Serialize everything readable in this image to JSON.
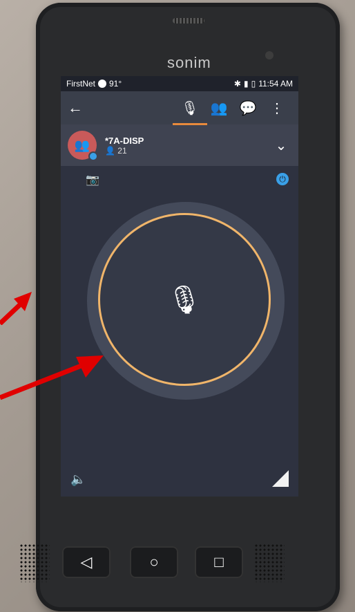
{
  "device": {
    "brand": "sonim"
  },
  "status_bar": {
    "carrier": "FirstNet",
    "extra": "91°",
    "time": "11:54 AM"
  },
  "toolbar": {
    "back_icon": "arrow-left-icon",
    "tabs": [
      {
        "icon": "microphone-icon",
        "active": true
      },
      {
        "icon": "group-icon",
        "active": false
      },
      {
        "icon": "message-icon",
        "active": false
      },
      {
        "icon": "more-vertical-icon",
        "active": false
      }
    ]
  },
  "group": {
    "name": "*7A-DISP",
    "members": "21"
  },
  "ptt": {
    "icon": "microphone-icon",
    "ring_color": "#f0b56a"
  },
  "colors": {
    "accent": "#e88a3c",
    "blue": "#3aa0e8",
    "arrow": "#e00000"
  }
}
